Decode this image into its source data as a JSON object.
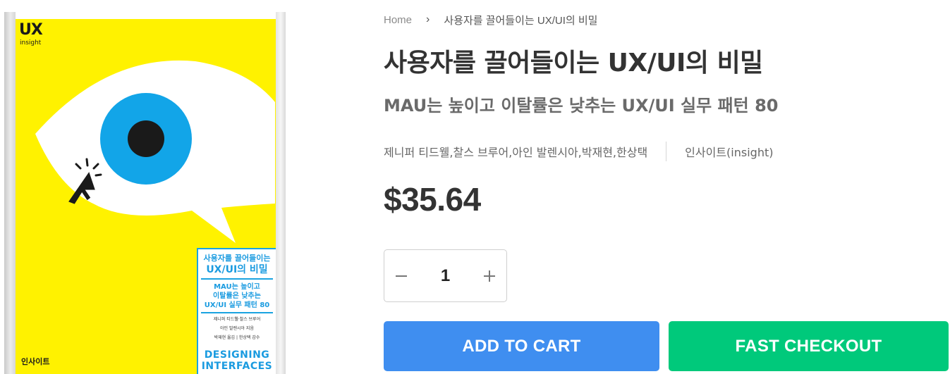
{
  "cover": {
    "logo": "UX",
    "logo_sub": "insight",
    "box_title_line1": "사용자를 끌어들이는",
    "box_title_line2": "UX/UI의 비밀",
    "box_sub_line1": "MAU는 높이고",
    "box_sub_line2": "이탈률은 낮추는",
    "box_sub_line3": "UX/UI 실무 패턴 80",
    "box_authors_line1": "제니퍼 티드웰·찰스 브루어",
    "box_authors_line2": "아인 발렌시아 지음",
    "box_authors_line3": "박재현 옮김 | 한상택 감수",
    "box_en_line1": "DESIGNING",
    "box_en_line2": "INTERFACES",
    "publisher_mark": "인사이트",
    "colors": {
      "background": "#fff200",
      "iris": "#12a5e8",
      "pupil": "#1a1a1a",
      "accent": "#1aa3e0"
    }
  },
  "breadcrumb": {
    "home": "Home",
    "separator": "›",
    "current": "사용자를 끌어들이는 UX/UI의 비밀"
  },
  "product": {
    "title": "사용자를 끌어들이는 UX/UI의 비밀",
    "subtitle": "MAU는 높이고 이탈률은 낮추는 UX/UI 실무 패턴 80",
    "authors": "제니퍼 티드웰,찰스 브루어,아인 발렌시아,박재현,한상택",
    "publisher": "인사이트(insight)",
    "price": "$35.64"
  },
  "quantity": {
    "value": "1",
    "decrement_icon": "minus-icon",
    "increment_icon": "plus-icon"
  },
  "actions": {
    "add_to_cart": "ADD TO CART",
    "fast_checkout": "FAST CHECKOUT"
  },
  "colors": {
    "add_to_cart": "#3f8ef0",
    "fast_checkout": "#00c97b",
    "title_text": "#333333"
  }
}
